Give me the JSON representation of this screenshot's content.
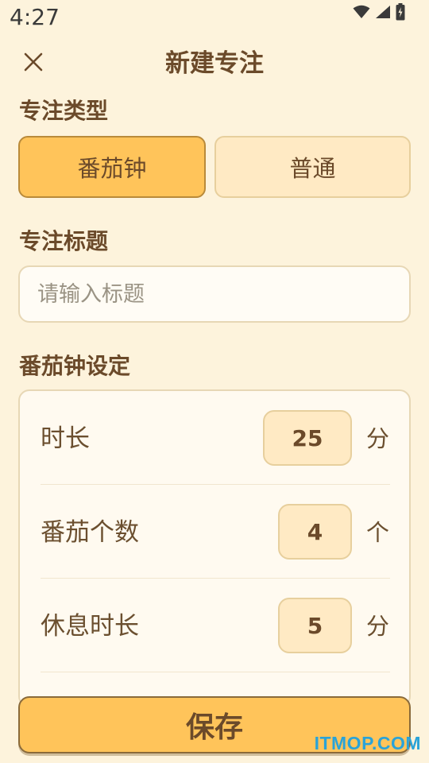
{
  "status_bar": {
    "time": "4:27",
    "icons": [
      "wifi-icon",
      "cellular-signal-icon",
      "battery-charging-icon"
    ]
  },
  "header": {
    "close_icon": "close-icon",
    "title": "新建专注"
  },
  "focus_type": {
    "label": "专注类型",
    "options": [
      {
        "label": "番茄钟",
        "selected": true
      },
      {
        "label": "普通",
        "selected": false
      }
    ]
  },
  "focus_title": {
    "label": "专注标题",
    "value": "",
    "placeholder": "请输入标题"
  },
  "pomodoro_settings": {
    "label": "番茄钟设定",
    "rows": [
      {
        "label": "时长",
        "value": "25",
        "unit": "分"
      },
      {
        "label": "番茄个数",
        "value": "4",
        "unit": "个"
      },
      {
        "label": "休息时长",
        "value": "5",
        "unit": "分"
      }
    ]
  },
  "save_label": "保存",
  "watermark": "ITMOP.COM",
  "colors": {
    "background": "#fdf3dc",
    "accent": "#ffc45a",
    "accent_light": "#ffeac4",
    "text": "#6b4a2a",
    "watermark": "#2aa3d8"
  }
}
